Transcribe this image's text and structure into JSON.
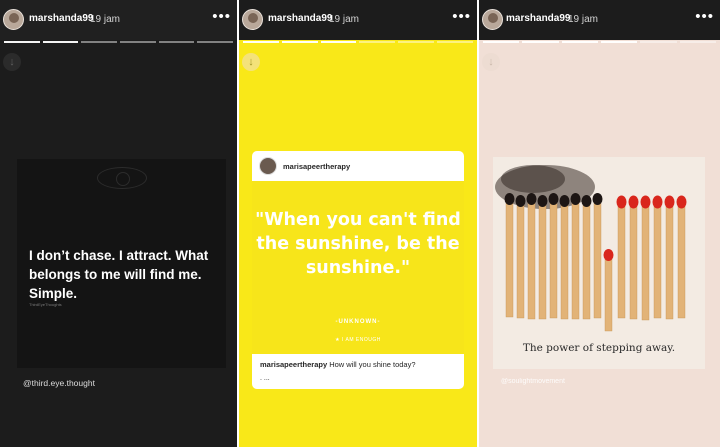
{
  "stories": [
    {
      "username": "marshanda99",
      "time": "19 jam",
      "quote": "I don’t chase. I attract. What belongs to me will find me. Simple.",
      "small_credit": "ThirdEyeThoughts",
      "handle": "@third.eye.thought"
    },
    {
      "username": "marshanda99",
      "time": "19 jam",
      "post_username": "marisapeertherapy",
      "quote": "\"When you can't find the sunshine, be the sunshine.\"",
      "attribution": "-UNKNOWN-",
      "brand": "I AM ENOUGH",
      "caption_user": "marisapeertherapy",
      "caption_text": "How will you shine today?",
      "caption_more": ". ..."
    },
    {
      "username": "marshanda99",
      "time": "19 jam",
      "caption": "The power of stepping away.",
      "handle": "@soulightmovement"
    }
  ],
  "icons": {
    "more": "more-dots-icon",
    "download": "download-arrow-icon",
    "avatar": "avatar"
  },
  "colors": {
    "yellow": "#f9e818",
    "dark": "#1c1c1c",
    "match_head": "#d9261c"
  }
}
